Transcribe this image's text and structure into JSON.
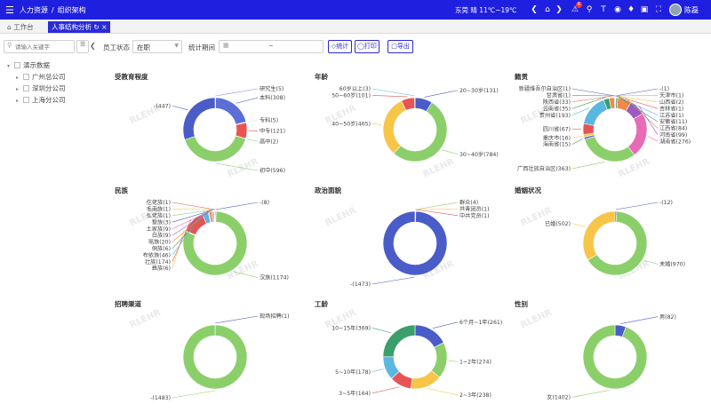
{
  "header": {
    "module": "人力资源",
    "separator": "/",
    "page": "组织架构",
    "weather": "东莞 晴 11℃~19℃",
    "badge": "6",
    "user": "陈磊"
  },
  "tabs": {
    "home": "工作台",
    "active": "人事结构分析"
  },
  "toolbar": {
    "search_placeholder": "请输入关键字",
    "status_label": "员工状态",
    "status_value": "在职",
    "period_label": "统计期间",
    "period_sep": "~",
    "stat_btn": "统计",
    "print_btn": "打印",
    "export_btn": "导出"
  },
  "tree": {
    "root": "演示数据",
    "children": [
      "广州总公司",
      "深圳分公司",
      "上海分公司"
    ]
  },
  "watermark": "RLEHR",
  "chart_data": [
    {
      "type": "pie",
      "title": "受教育程度",
      "labels": [
        "研究生",
        "本科",
        "专科",
        "中专",
        "高中",
        "初中",
        "-"
      ],
      "values": [
        5,
        308,
        5,
        121,
        2,
        596,
        447
      ],
      "colors": [
        "#8a8ae0",
        "#5b6fd6",
        "#e3f0d9",
        "#e85454",
        "#9ed67a",
        "#8bcf6a",
        "#4a5cc8"
      ]
    },
    {
      "type": "pie",
      "title": "年龄",
      "labels": [
        "20~30岁",
        "30~40岁",
        "40~50岁",
        "50~60岁",
        "60岁以上"
      ],
      "values": [
        131,
        784,
        465,
        101,
        3
      ],
      "colors": [
        "#4a5cc8",
        "#8bcf6a",
        "#f7c548",
        "#e85454",
        "#5ab7e0"
      ]
    },
    {
      "type": "pie",
      "title": "籍贯",
      "labels": [
        "-",
        "天津市",
        "山西省",
        "吉林省",
        "江苏省",
        "安徽省",
        "江西省",
        "河南省",
        "湖南省",
        "广西壮族自治区",
        "海南省",
        "重庆市",
        "四川省",
        "贵州省",
        "云南省",
        "陕西省",
        "甘肃省",
        "新疆维吾尔自治区"
      ],
      "values": [
        1,
        1,
        2,
        1,
        1,
        11,
        84,
        99,
        276,
        363,
        15,
        16,
        67,
        193,
        35,
        33,
        1,
        1
      ],
      "colors": [
        "#4a5cc8",
        "#8bcf6a",
        "#f7c548",
        "#e85454",
        "#5ab7e0",
        "#3b9e6b",
        "#f08a4b",
        "#9c5bc2",
        "#e86bb5",
        "#8bcf6a",
        "#5b6fd6",
        "#f7c548",
        "#e85454",
        "#5ab7e0",
        "#3b9e6b",
        "#f08a4b",
        "#9c5bc2",
        "#4a5cc8"
      ]
    },
    {
      "type": "pie",
      "title": "民族",
      "labels": [
        "-",
        "汉族",
        "彝族",
        "壮族",
        "布依族",
        "侗族",
        "瑶族",
        "白族",
        "土家族",
        "黎族",
        "仫佬族",
        "毛南族",
        "仡佬族"
      ],
      "values": [
        8,
        1174,
        6,
        174,
        46,
        6,
        20,
        9,
        9,
        3,
        1,
        1,
        1
      ],
      "colors": [
        "#4a5cc8",
        "#8bcf6a",
        "#f7c548",
        "#e85454",
        "#5ab7e0",
        "#3b9e6b",
        "#f08a4b",
        "#9c5bc2",
        "#e86bb5",
        "#4a5cc8",
        "#8bcf6a",
        "#f7c548",
        "#e85454"
      ]
    },
    {
      "type": "pie",
      "title": "政治面貌",
      "labels": [
        "群众",
        "共青团员",
        "中共党员",
        "-"
      ],
      "values": [
        4,
        1,
        1,
        1473
      ],
      "colors": [
        "#8bcf6a",
        "#f7c548",
        "#e85454",
        "#4a5cc8"
      ]
    },
    {
      "type": "pie",
      "title": "婚姻状况",
      "labels": [
        "-",
        "未婚",
        "已婚"
      ],
      "values": [
        12,
        970,
        502
      ],
      "colors": [
        "#4a5cc8",
        "#8bcf6a",
        "#f7c548"
      ]
    },
    {
      "type": "pie",
      "title": "招聘渠道",
      "labels": [
        "现场招聘",
        "-"
      ],
      "values": [
        1,
        1483
      ],
      "colors": [
        "#4a5cc8",
        "#8bcf6a"
      ]
    },
    {
      "type": "pie",
      "title": "工龄",
      "labels": [
        "6个月~1年",
        "1~2年",
        "2~3年",
        "3~5年",
        "5~10年",
        "10~15年"
      ],
      "values": [
        261,
        274,
        238,
        164,
        178,
        369
      ],
      "colors": [
        "#4a5cc8",
        "#8bcf6a",
        "#f7c548",
        "#e85454",
        "#5ab7e0",
        "#3b9e6b"
      ]
    },
    {
      "type": "pie",
      "title": "性别",
      "labels": [
        "男",
        "女"
      ],
      "values": [
        82,
        1402
      ],
      "colors": [
        "#4a5cc8",
        "#8bcf6a"
      ]
    }
  ]
}
